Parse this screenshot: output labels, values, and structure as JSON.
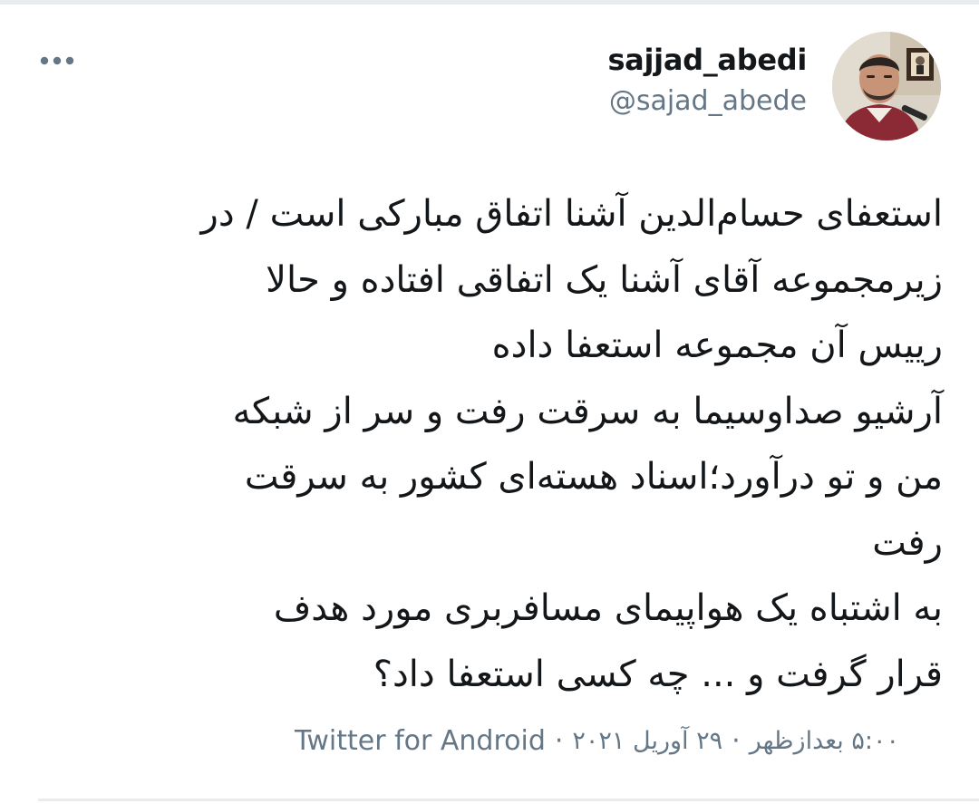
{
  "tweet": {
    "display_name": "sajjad_abedi",
    "handle": "@sajad_abede",
    "text_lines": [
      "استعفای حسام‌الدین آشنا اتفاق مبارکی است / در",
      "زیرمجموعه آقای آشنا یک اتفاقی افتاده و حالا",
      "رییس آن مجموعه استعفا داده",
      "آرشیو صداوسیما به سرقت رفت و سر از شبکه",
      "من و تو درآورد؛اسناد هسته‌ای کشور به سرقت",
      "رفت",
      "به اشتباه یک هواپیمای مسافربری مورد هدف",
      "قرار گرفت و ... چه کسی استعفا داد؟"
    ],
    "source": "Twitter for Android",
    "separator": "·",
    "date": "۲۹ آوریل ۲۰۲۱",
    "time": "۵:۰۰ بعدازظهر"
  },
  "icons": {
    "more": "more-horizontal-icon"
  },
  "colors": {
    "text_primary": "#14171a",
    "text_secondary": "#657786",
    "divider": "#e6ecf0"
  }
}
